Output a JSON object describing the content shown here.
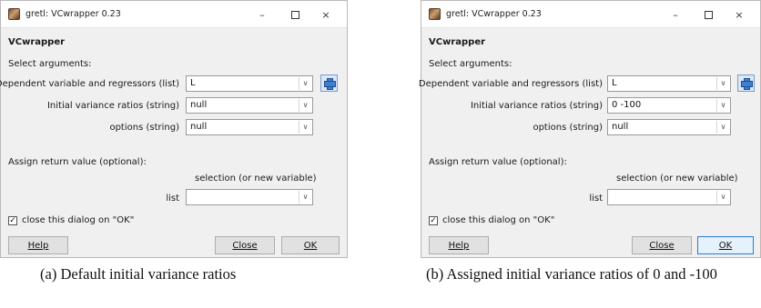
{
  "panel_a": {
    "title": "gretl: VCwrapper 0.23",
    "heading": "VCwrapper",
    "select_args": "Select arguments:",
    "dep_label": "Dependent variable and regressors (list)",
    "dep_value": "L",
    "ivr_label": "Initial variance ratios (string)",
    "ivr_value": "null",
    "opt_label": "options (string)",
    "opt_value": "null",
    "assign_label": "Assign return value (optional):",
    "selection_label": "selection (or new variable)",
    "list_label": "list",
    "list_value": "",
    "checkbox_label": "close this dialog on \"OK\"",
    "help": "Help",
    "close": "Close",
    "ok": "OK"
  },
  "panel_b": {
    "title": "gretl: VCwrapper 0.23",
    "heading": "VCwrapper",
    "select_args": "Select arguments:",
    "dep_label": "Dependent variable and regressors (list)",
    "dep_value": "L",
    "ivr_label": "Initial variance ratios (string)",
    "ivr_value": "0 -100",
    "opt_label": "options (string)",
    "opt_value": "null",
    "assign_label": "Assign return value (optional):",
    "selection_label": "selection (or new variable)",
    "list_label": "list",
    "list_value": "",
    "checkbox_label": "close this dialog on \"OK\"",
    "help": "Help",
    "close": "Close",
    "ok": "OK"
  },
  "captions": {
    "a": "(a) Default initial variance ratios",
    "b": "(b)   Assigned   initial   variance   ratios of 0 and -100"
  },
  "icons": {
    "window_minimize": "–",
    "window_close": "×",
    "dropdown_arrow": "∨",
    "checkbox_checked": "✓"
  },
  "colors": {
    "default_button_border": "#2b79d7",
    "plus_button_fill": "#3f7fd0"
  }
}
